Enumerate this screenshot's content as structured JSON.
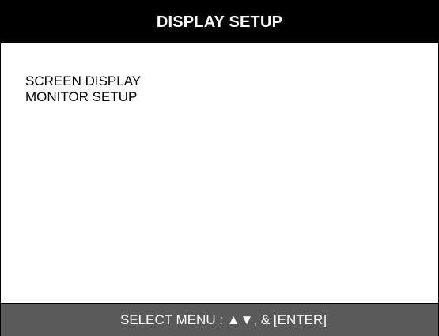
{
  "window": {
    "title": "DISPLAY SETUP"
  },
  "menu": {
    "items": [
      {
        "label": "SCREEN DISPLAY"
      },
      {
        "label": "MONITOR SETUP"
      }
    ]
  },
  "footer": {
    "hint": "SELECT MENU : ▲▼, & [ENTER]"
  },
  "colors": {
    "title_background": "#000000",
    "title_text": "#ffffff",
    "body_background": "#ffffff",
    "footer_background": "#5a5a5a",
    "footer_text": "#ffffff"
  }
}
